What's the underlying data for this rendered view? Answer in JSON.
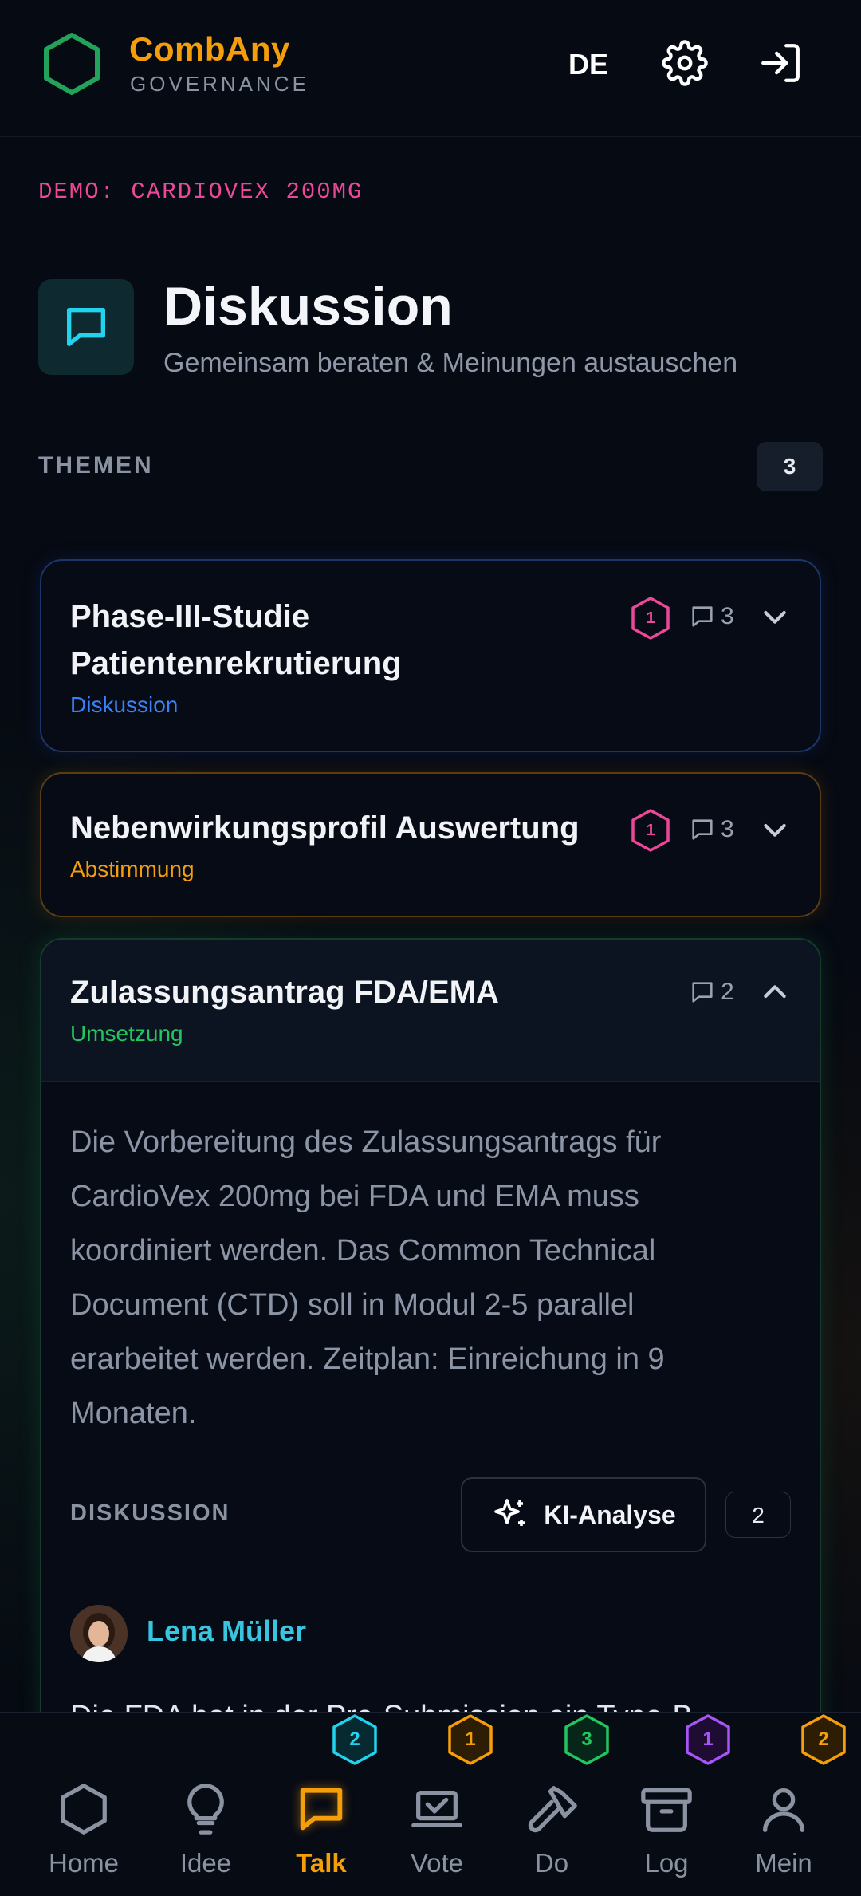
{
  "header": {
    "brand_name": "CombAny",
    "brand_sub": "GOVERNANCE",
    "lang": "DE",
    "icons": [
      "hexagon-logo-icon",
      "gear-icon",
      "logout-icon"
    ]
  },
  "demo_label": "DEMO: CARDIOVEX 200MG",
  "page": {
    "title": "Diskussion",
    "subtitle": "Gemeinsam beraten & Meinungen austauschen",
    "icon": "chat-bubble-icon"
  },
  "themes": {
    "label": "THEMEN",
    "count": "3",
    "items": [
      {
        "title_line1": "Phase-III-Studie",
        "title_line2": "Patientenrekrutierung",
        "tag": "Diskussion",
        "tag_color": "#3b82f6",
        "badge": "1",
        "comments": "3",
        "expanded": false
      },
      {
        "title_line1": "Nebenwirkungsprofil Auswertung",
        "tag": "Abstimmung",
        "tag_color": "#f59e0b",
        "badge": "1",
        "comments": "3",
        "expanded": false
      },
      {
        "title_line1": "Zulassungsantrag FDA/EMA",
        "tag": "Umsetzung",
        "tag_color": "#22c55e",
        "comments": "2",
        "expanded": true,
        "body_lines": [
          "Die Vorbereitung des Zulassungsantrags für",
          "CardioVex 200mg bei FDA und EMA muss",
          "koordiniert werden. Das Common Technical",
          "Document (CTD) soll in Modul 2-5 parallel",
          "erarbeitet werden. Zeitplan: Einreichung in 9",
          "Monaten."
        ],
        "discussion_label": "DISKUSSION",
        "ki_button": "KI-Analyse",
        "discussion_count": "2",
        "first_comment": {
          "author": "Lena Müller",
          "text": "Die FDA hat in der Pre-Submission ein Type-B-"
        }
      }
    ]
  },
  "nav": {
    "items": [
      {
        "label": "Home",
        "icon": "hexagon-icon",
        "active": false
      },
      {
        "label": "Idee",
        "icon": "lightbulb-icon",
        "active": false
      },
      {
        "label": "Talk",
        "icon": "chat-icon",
        "active": true,
        "badge": "2",
        "badge_color": "#22d3ee"
      },
      {
        "label": "Vote",
        "icon": "vote-laptop-icon",
        "active": false,
        "badge": "1",
        "badge_color": "#f59e0b"
      },
      {
        "label": "Do",
        "icon": "hammer-icon",
        "active": false,
        "badge": "3",
        "badge_color": "#22c55e"
      },
      {
        "label": "Log",
        "icon": "archive-icon",
        "active": false,
        "badge": "1",
        "badge_color": "#a855f7"
      },
      {
        "label": "Mein",
        "icon": "user-icon",
        "active": false,
        "badge": "2",
        "badge_color": "#f59e0b"
      }
    ]
  },
  "colors": {
    "accent_orange": "#f59e0b",
    "accent_cyan": "#22d3ee",
    "accent_pink": "#ec4899",
    "background": "#060a12"
  }
}
